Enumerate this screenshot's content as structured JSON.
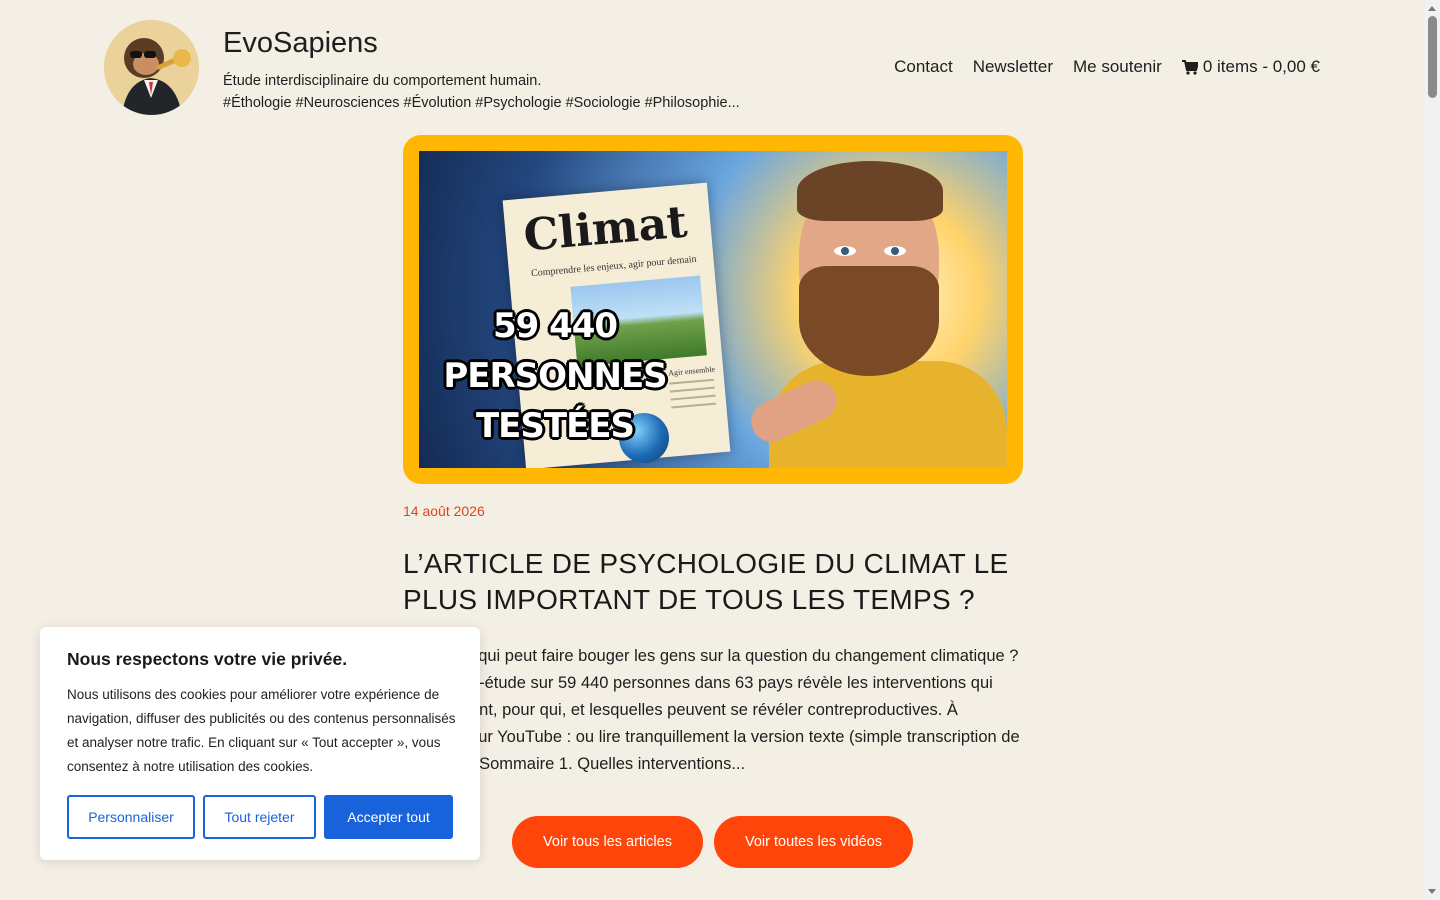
{
  "header": {
    "site_title": "EvoSapiens",
    "tagline_line1": "Étude interdisciplinaire du comportement humain.",
    "tagline_line2": "#Éthologie #Neurosciences #Évolution #Psychologie #Sociologie #Philosophie...",
    "nav": {
      "contact": "Contact",
      "newsletter": "Newsletter",
      "support": "Me soutenir",
      "cart": "0 items - 0,00 €"
    }
  },
  "featured": {
    "paper_title": "Climat",
    "paper_subtitle": "Comprendre les enjeux, agir pour demain",
    "paper_section": "Agir ensemble",
    "headline_line1": "59 440",
    "headline_line2": "PERSONNES",
    "headline_line3": "TESTÉES"
  },
  "post": {
    "date": "14 août 2026",
    "title": "L’ARTICLE DE PSYCHOLOGIE DU CLIMAT LE PLUS IMPORTANT DE TOUS LES TEMPS ?",
    "excerpt": "Qu’est-ce qui peut faire bouger les gens sur la question du changement climatique ? Une méga-étude sur 59 440 personnes dans 63 pays révèle les interventions qui fonctionnent, pour qui, et lesquelles peuvent se révéler contreproductives. À regarder sur YouTube : ou lire tranquillement la version texte (simple transcription de la vidéo) : Sommaire 1. Quelles interventions..."
  },
  "actions": {
    "all_articles": "Voir tous les articles",
    "all_videos": "Voir toutes les vidéos"
  },
  "cookie": {
    "title": "Nous respectons votre vie privée.",
    "text": "Nous utilisons des cookies pour améliorer votre expérience de navigation, diffuser des publicités ou des contenus personnalisés et analyser notre trafic. En cliquant sur « Tout accepter », vous consentez à notre utilisation des cookies.",
    "customize": "Personnaliser",
    "reject_all": "Tout rejeter",
    "accept_all": "Accepter tout"
  },
  "colors": {
    "background": "#f4efe5",
    "accent_orange": "#ff4509",
    "date_color": "#e0441b",
    "card_border": "#ffb703",
    "cookie_blue": "#1863dc"
  },
  "icons": {
    "cart": "cart-icon",
    "logo": "monkey-trumpet-logo"
  }
}
